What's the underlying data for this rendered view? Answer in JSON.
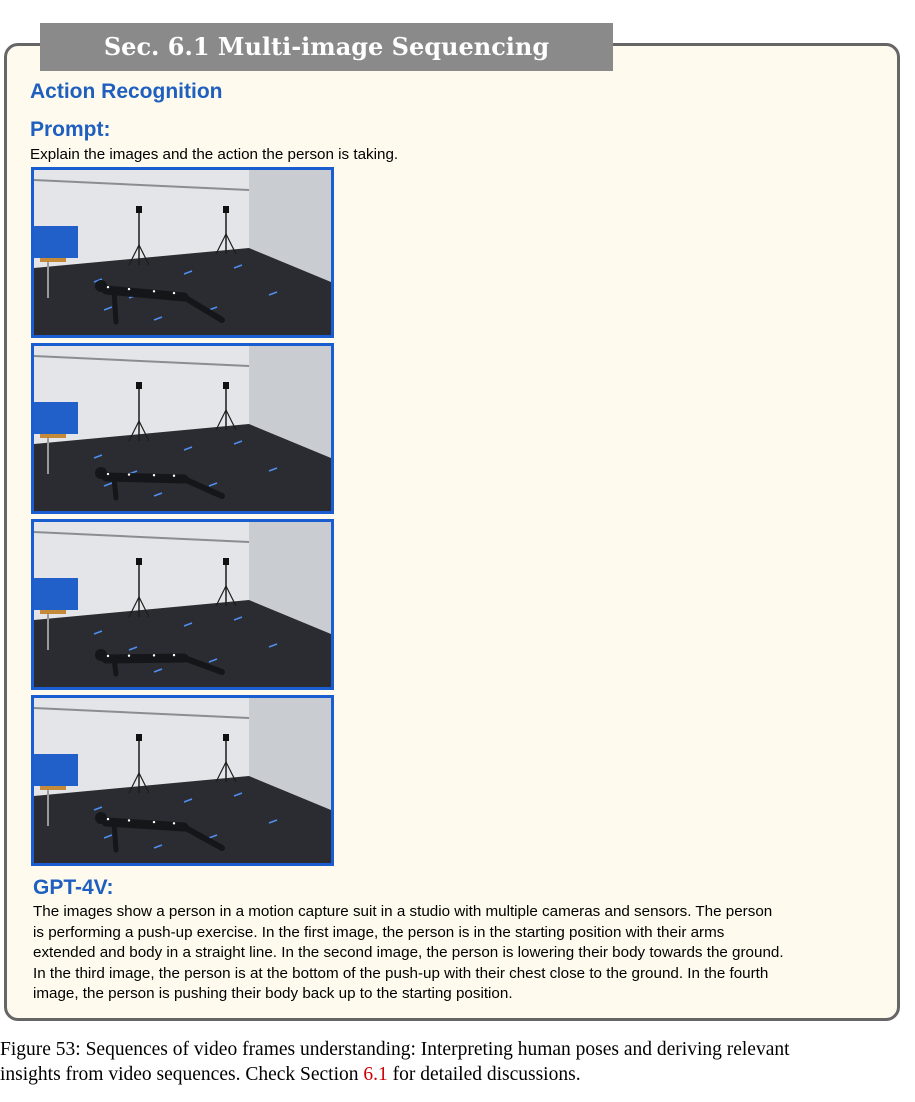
{
  "banner": {
    "title": "Sec. 6.1 Multi-image Sequencing"
  },
  "section": {
    "title": "Action Recognition"
  },
  "prompt": {
    "label": "Prompt:",
    "text": "Explain the images and the action the person is taking."
  },
  "frames": [
    {
      "pose": "arms-extended"
    },
    {
      "pose": "lowering"
    },
    {
      "pose": "bottom"
    },
    {
      "pose": "pushing-up"
    }
  ],
  "response": {
    "label": "GPT-4V:",
    "lines": [
      "The images show a person in a motion capture suit in a studio with multiple cameras and sensors. The person",
      "is performing a push-up exercise. In the first image, the person is in the starting position with their arms",
      "extended and body in a straight line. In the second image, the person is lowering their body towards the ground.",
      "In the third image, the person is at the bottom of the push-up with their chest close to the ground. In the fourth",
      "image, the person is pushing their body back up to the starting position."
    ]
  },
  "caption": {
    "line1": "Figure 53: Sequences of video frames understanding: Interpreting human poses and deriving relevant",
    "line2_prefix": "insights from video sequences. Check Section ",
    "line2_ref": "6.1",
    "line2_suffix": " for detailed discussions."
  },
  "colors": {
    "panel_bg": "#fefaed",
    "banner_bg": "#8a8a8a",
    "heading": "#1e5fbf",
    "frame_border": "#1a5dd0",
    "ref": "#cc0000"
  }
}
